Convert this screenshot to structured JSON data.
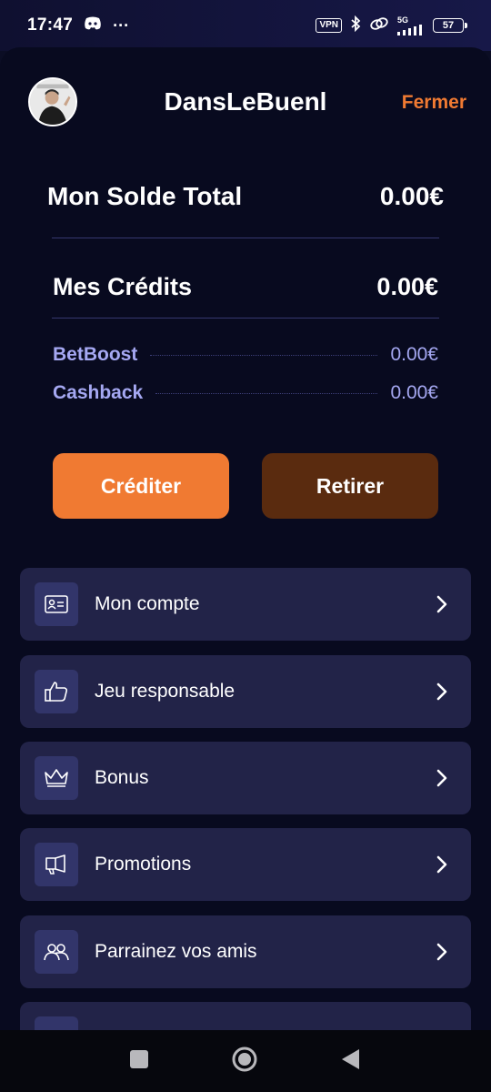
{
  "status_bar": {
    "time": "17:47",
    "more": "···",
    "vpn": "VPN",
    "network": "5G",
    "battery": "57"
  },
  "header": {
    "username": "DansLeBuenl",
    "close_label": "Fermer"
  },
  "balance": {
    "total_label": "Mon Solde Total",
    "total_value": "0.00€",
    "credits_label": "Mes Crédits",
    "credits_value": "0.00€",
    "betboost_label": "BetBoost",
    "betboost_value": "0.00€",
    "cashback_label": "Cashback",
    "cashback_value": "0.00€"
  },
  "actions": {
    "credit_label": "Créditer",
    "withdraw_label": "Retirer"
  },
  "menu": {
    "items": [
      {
        "label": "Mon compte",
        "icon": "id-card-icon"
      },
      {
        "label": "Jeu responsable",
        "icon": "thumbs-up-icon"
      },
      {
        "label": "Bonus",
        "icon": "crown-icon"
      },
      {
        "label": "Promotions",
        "icon": "megaphone-icon"
      },
      {
        "label": "Parrainez vos amis",
        "icon": "users-icon"
      }
    ]
  },
  "colors": {
    "accent": "#f07a32",
    "withdraw": "#5a2b0f",
    "card": "#222348",
    "sub_text": "#a5a8f2",
    "background": "#080a1f"
  }
}
